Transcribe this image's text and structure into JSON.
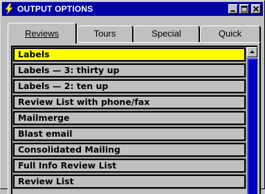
{
  "window": {
    "title": "OUTPUT OPTIONS",
    "controls": {
      "minimize_icon": "minimize-icon",
      "maximize_icon": "maximize-icon",
      "close_icon": "close-icon"
    }
  },
  "tabs": [
    {
      "label": "Reviews",
      "active": true
    },
    {
      "label": "Tours",
      "active": false
    },
    {
      "label": "Special",
      "active": false
    },
    {
      "label": "Quick",
      "active": false
    }
  ],
  "list": {
    "items": [
      "Labels",
      "Labels — 3: thirty up",
      "Labels — 2: ten up",
      "Review List with phone/fax",
      "Mailmerge",
      "Blast email",
      "Consolidated Mailing",
      "Full Info Review List",
      "Review List"
    ],
    "selected_index": 0
  },
  "colors": {
    "titlebar": "#0000a8",
    "selected_row": "#ffff00",
    "scroll_thumb": "#0000c8"
  }
}
